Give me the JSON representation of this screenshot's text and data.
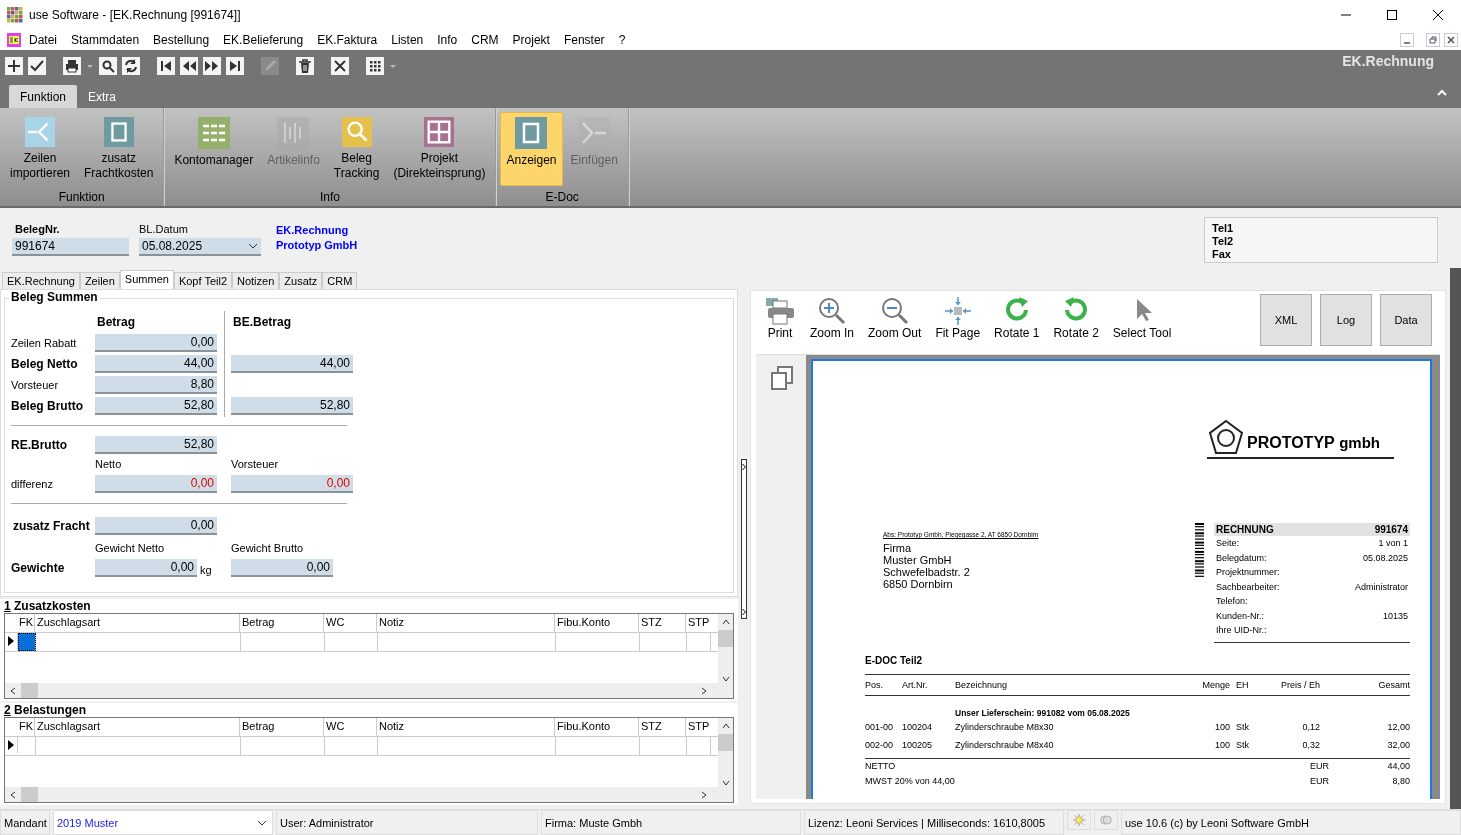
{
  "window": {
    "title": "use Software - [EK.Rechnung [991674]]"
  },
  "menu": [
    "Datei",
    "Stammdaten",
    "Bestellung",
    "EK.Belieferung",
    "EK.Faktura",
    "Listen",
    "Info",
    "CRM",
    "Projekt",
    "Fenster",
    "?"
  ],
  "toolbar": [
    [
      {
        "kind": "add",
        "disabled": false
      },
      {
        "kind": "check",
        "disabled": false
      }
    ],
    [
      {
        "kind": "print",
        "disabled": false
      },
      {
        "kind": "caret",
        "disabled": false
      },
      {
        "kind": "search",
        "disabled": false
      },
      {
        "kind": "refresh",
        "disabled": false
      }
    ],
    [
      {
        "kind": "first",
        "disabled": false
      },
      {
        "kind": "prev",
        "disabled": false
      },
      {
        "kind": "next",
        "disabled": false
      },
      {
        "kind": "last",
        "disabled": false
      }
    ],
    [
      {
        "kind": "edit",
        "disabled": true
      }
    ],
    [
      {
        "kind": "delete",
        "disabled": false
      }
    ],
    [
      {
        "kind": "close",
        "disabled": false
      }
    ],
    [
      {
        "kind": "grid",
        "disabled": false
      },
      {
        "kind": "caret",
        "disabled": false
      }
    ]
  ],
  "module_title": "EK.Rechnung",
  "ribbon_tabs": [
    {
      "label": "Funktion",
      "selected": true
    },
    {
      "label": "Extra",
      "selected": false
    }
  ],
  "ribbon_groups": [
    {
      "label": "Funktion",
      "buttons": [
        {
          "label": "Zeilen\nimportieren",
          "kind": "import",
          "disabled": false,
          "selected": false
        },
        {
          "label": "zusatz\nFrachtkosten",
          "kind": "frame",
          "disabled": false,
          "selected": false
        }
      ]
    },
    {
      "label": "Info",
      "buttons": [
        {
          "label": "Kontomanager",
          "kind": "list",
          "disabled": false,
          "selected": false
        },
        {
          "label": "Artikelinfo",
          "kind": "bars",
          "disabled": true,
          "selected": false
        },
        {
          "label": "Beleg\nTracking",
          "kind": "search",
          "disabled": false,
          "selected": false
        },
        {
          "label": "Projekt\n(Direkteinsprung)",
          "kind": "layout",
          "disabled": false,
          "selected": false
        }
      ]
    },
    {
      "label": "E-Doc",
      "buttons": [
        {
          "label": "Anzeigen",
          "kind": "frame",
          "disabled": false,
          "selected": true
        },
        {
          "label": "Einfügen",
          "kind": "insert",
          "disabled": true,
          "selected": false
        }
      ]
    }
  ],
  "header": {
    "beleg_nr": {
      "label": "BelegNr.",
      "value": "991674"
    },
    "datum": {
      "label": "BL.Datum",
      "value": "05.08.2025"
    },
    "links": [
      "EK.Rechnung",
      "Prototyp GmbH"
    ],
    "contact": [
      "Tel1",
      "Tel2",
      "Fax"
    ]
  },
  "doc_tabs": [
    {
      "label": "EK.Rechnung",
      "selected": false
    },
    {
      "label": "Zeilen",
      "selected": false
    },
    {
      "label": "Summen",
      "selected": true
    },
    {
      "label": "Kopf Teil2",
      "selected": false
    },
    {
      "label": "Notizen",
      "selected": false
    },
    {
      "label": "Zusatz",
      "selected": false
    },
    {
      "label": "CRM",
      "selected": false
    }
  ],
  "summen": {
    "title": "Beleg Summen",
    "headers": [
      "Betrag",
      "BE.Betrag"
    ],
    "rows": [
      {
        "label": "Zeilen Rabatt",
        "bold": false,
        "betrag": "0,00"
      },
      {
        "label": "Beleg Netto",
        "bold": true,
        "betrag": "44,00",
        "be_betrag": "44,00"
      },
      {
        "label": "Vorsteuer",
        "bold": false,
        "betrag": "8,80"
      },
      {
        "label": "Beleg Brutto",
        "bold": true,
        "betrag": "52,80",
        "be_betrag": "52,80"
      }
    ],
    "re_brutto": {
      "label": "RE.Brutto",
      "value": "52,80"
    },
    "differenz": {
      "label": "differenz",
      "captions": [
        "Netto",
        "Vorsteuer"
      ],
      "values": [
        "0,00",
        "0,00"
      ]
    },
    "fracht": {
      "label": "zusatz Fracht",
      "value": "0,00"
    },
    "gewichte": {
      "label": "Gewichte",
      "captions": [
        "Gewicht Netto",
        "Gewicht Brutto"
      ],
      "values": [
        "0,00",
        "0,00"
      ],
      "unit": "kg"
    }
  },
  "grids": [
    {
      "number": "1",
      "title": "Zusatzkosten",
      "columns": [
        "FK",
        "Zuschlagsart",
        "Betrag",
        "WC",
        "Notiz",
        "Fibu.Konto",
        "STZ",
        "STP"
      ],
      "cell_selected": true
    },
    {
      "number": "2",
      "title": "Belastungen",
      "columns": [
        "FK",
        "Zuschlagsart",
        "Betrag",
        "WC",
        "Notiz",
        "Fibu.Konto",
        "STZ",
        "STP"
      ],
      "cell_selected": false
    }
  ],
  "viewer": {
    "tools": [
      {
        "label": "Print",
        "kind": "print"
      },
      {
        "label": "Zoom In",
        "kind": "zoom-in"
      },
      {
        "label": "Zoom Out",
        "kind": "zoom-out"
      },
      {
        "label": "Fit Page",
        "kind": "fit"
      },
      {
        "label": "Rotate 1",
        "kind": "rotate-cw"
      },
      {
        "label": "Rotate 2",
        "kind": "rotate-ccw"
      },
      {
        "label": "Select Tool",
        "kind": "pointer"
      }
    ],
    "buttons": [
      "XML",
      "Log",
      "Data"
    ],
    "document": {
      "logo": {
        "name": "PROTOTYP",
        "suffix": "gmbh"
      },
      "sender": "Abs: Prototyp Gmbh, Piegegasse 2, AT 6850 Dornbirn",
      "address": [
        "Firma",
        "Muster GmbH",
        "Schwefelbadstr. 2",
        "6850 Dornbirn"
      ],
      "info": {
        "title": "RECHNUNG",
        "number": "991674",
        "fields": [
          {
            "label": "Seite:",
            "value": "1 von 1"
          },
          {
            "label": "Belegdatum:",
            "value": "05.08.2025"
          },
          {
            "label": "Projektnummer:"
          },
          {
            "label": "Sachbearbeiter:",
            "value": "Administrator"
          },
          {
            "label": "Telefon:"
          },
          {
            "label": "Kunden-Nr.:",
            "value": "10135"
          },
          {
            "label": "Ihre UID-Nr.:"
          }
        ]
      },
      "section": "E-DOC Teil2",
      "columns": [
        "Pos.",
        "Art.Nr.",
        "Bezeichnung",
        "Menge",
        "EH",
        "Preis / Eh",
        "Gesamt"
      ],
      "note": "Unser Lieferschein: 991082 vom 05.08.2025",
      "items": [
        [
          "001-00",
          "100204",
          "Zylinderschraube M8x30",
          "100",
          "Stk",
          "0,12",
          "12,00"
        ],
        [
          "002-00",
          "100205",
          "Zylinderschraube M8x40",
          "100",
          "Stk",
          "0,32",
          "32,00"
        ]
      ],
      "totals": [
        {
          "label": "NETTO",
          "currency": "EUR",
          "value": "44,00"
        },
        {
          "label": "MWST 20% von 44,00",
          "currency": "EUR",
          "value": "8,80"
        }
      ]
    }
  },
  "status": {
    "mandant_label": "Mandant",
    "mandant": "2019 Muster",
    "user": "User: Administrator",
    "firma": "Firma: Muste Gmbh",
    "lizenz": "Lizenz: Leoni Services | Milliseconds: 1610,8005",
    "version": "use 10.6 (c) by Leoni Software GmbH"
  }
}
